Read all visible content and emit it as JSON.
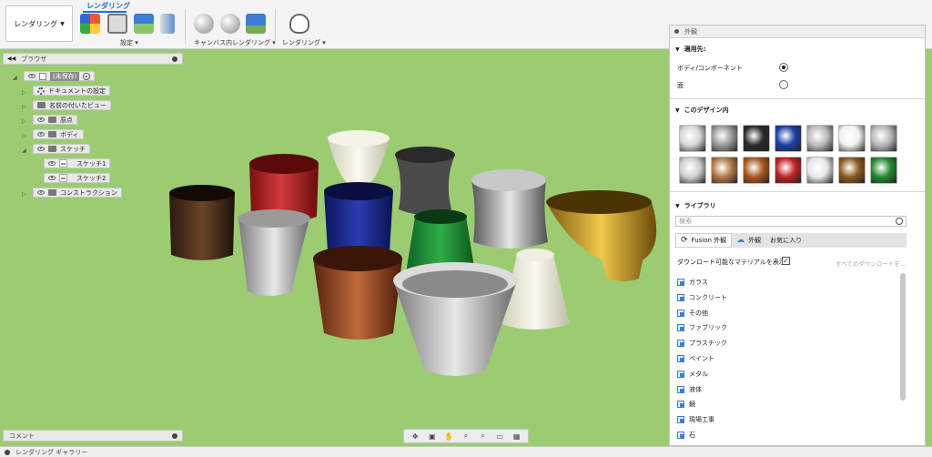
{
  "toolbar": {
    "workspace": "レンダリング",
    "active_tab": "レンダリング",
    "groups": [
      "設定",
      "キャンバス内レンダリング",
      "レンダリング"
    ]
  },
  "browser": {
    "title": "ブラウザ",
    "items": [
      {
        "label": "(未保存)",
        "icon": "document-icon"
      },
      {
        "label": "ドキュメントの設定",
        "icon": "gear-icon"
      },
      {
        "label": "名前の付いたビュー",
        "icon": "folder-icon"
      },
      {
        "label": "原点",
        "icon": "folder-icon"
      },
      {
        "label": "ボディ",
        "icon": "folder-icon"
      },
      {
        "label": "スケッチ",
        "icon": "folder-icon"
      },
      {
        "label": "スケッチ1",
        "icon": "sketch-icon"
      },
      {
        "label": "スケッチ2",
        "icon": "sketch-icon"
      },
      {
        "label": "コンストラクション",
        "icon": "folder-icon"
      }
    ]
  },
  "comments": {
    "title": "コメント"
  },
  "gallery": {
    "title": "レンダリング ギャラリー"
  },
  "appearance": {
    "title": "外観",
    "apply_to": {
      "title": "適用先:",
      "options": [
        {
          "label": "ボディ/コンポーネント",
          "selected": true
        },
        {
          "label": "面",
          "selected": false
        }
      ]
    },
    "in_design": {
      "title": "このデザイン内",
      "swatch_colors": [
        "#d8d8d8",
        "#9a9a9a",
        "#2a2a2a",
        "#1b3fa8",
        "#bcbcbc",
        "#f2f2f2",
        "#b8b8b8",
        "#cfcfcf",
        "#b07a44",
        "#a8561e",
        "#c02020",
        "#e8e8e8",
        "#8a5a20",
        "#1f8a30"
      ]
    },
    "library": {
      "title": "ライブラリ",
      "search_placeholder": "検索",
      "tabs": [
        "Fusion 外観",
        "外観",
        "お気に入り"
      ],
      "download_label": "ダウンロード可能なマテリアルを表示",
      "download_all": "すべてのダウンロードを...",
      "items": [
        "ガラス",
        "コンクリート",
        "その他",
        "ファブリック",
        "プラスチック",
        "ペイント",
        "メタル",
        "液体",
        "鏡",
        "現場工事",
        "石"
      ]
    }
  }
}
